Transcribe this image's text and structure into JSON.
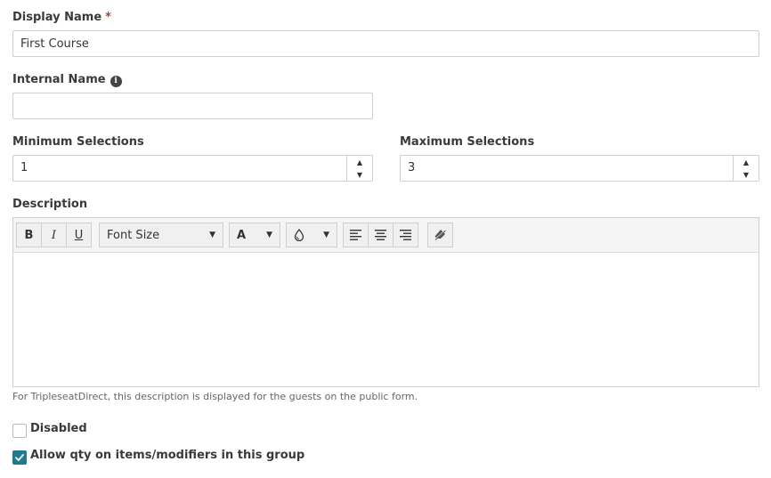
{
  "display_name": {
    "label": "Display Name",
    "required_mark": "*",
    "value": "First Course"
  },
  "internal_name": {
    "label": "Internal Name",
    "value": "",
    "info_icon": "info-icon"
  },
  "min_selections": {
    "label": "Minimum Selections",
    "value": "1"
  },
  "max_selections": {
    "label": "Maximum Selections",
    "value": "3"
  },
  "description": {
    "label": "Description",
    "toolbar": {
      "bold": "B",
      "italic": "I",
      "underline": "U",
      "font_size": "Font Size",
      "font_color": "A",
      "icons": [
        "droplet-icon",
        "align-left-icon",
        "align-center-icon",
        "align-right-icon",
        "clear-format-icon"
      ]
    },
    "help_text": "For TripleseatDirect, this description is displayed for the guests on the public form."
  },
  "options": {
    "disabled": {
      "label": "Disabled",
      "checked": false
    },
    "allow_qty": {
      "label": "Allow qty on items/modifiers in this group",
      "checked": true
    }
  },
  "colors": {
    "accent": "#1f7a8c",
    "required": "#c0392b",
    "border": "#cfcfcf"
  }
}
